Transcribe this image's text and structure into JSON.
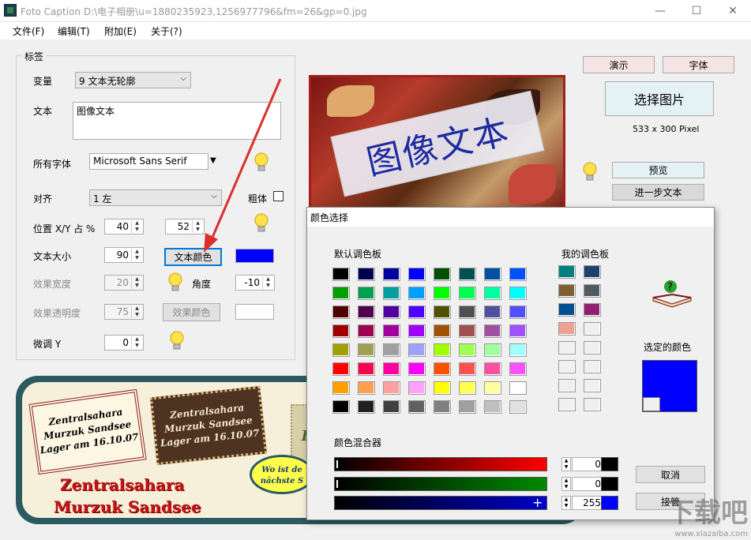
{
  "window": {
    "title": "Foto Caption D:\\电子相册\\u=1880235923,1256977796&fm=26&gp=0.jpg",
    "minimize": "—",
    "maximize": "☐",
    "close": "✕"
  },
  "menu": [
    "文件(F)",
    "编辑(T)",
    "附加(E)",
    "关于(?)"
  ],
  "group": {
    "label": "标签"
  },
  "form": {
    "variant_label": "变量",
    "variant_value": "9 文本无轮廓",
    "text_label": "文本",
    "text_value": "图像文本",
    "font_label": "所有字体",
    "font_value": "Microsoft Sans Serif",
    "align_label": "对齐",
    "align_value": "1 左",
    "bold_label": "粗体",
    "pos_label": "位置 X/Y 占 %",
    "pos_x": "40",
    "pos_y": "52",
    "size_label": "文本大小",
    "size_value": "90",
    "text_color_button": "文本颜色",
    "effect_width_label": "效果宽度",
    "effect_width_value": "20",
    "angle_label": "角度",
    "angle_value": "-10",
    "effect_opacity_label": "效果透明度",
    "effect_opacity_value": "75",
    "effect_color_button": "效果颜色",
    "fine_label": "微调 Y",
    "fine_value": "0"
  },
  "right_panel": {
    "demo_button": "演示",
    "font_button": "字体",
    "select_image_button": "选择图片",
    "image_size": "533 x 300 Pixel",
    "preview_button": "预览",
    "more_text_button": "进一步文本"
  },
  "preview_text": "图像文本",
  "banner": {
    "stamp1": [
      "Zentralsahara",
      "Murzuk Sandsee",
      "Lager am 16.10.07"
    ],
    "stamp2": [
      "Zentralsahara",
      "Murzuk Sandsee",
      "Lager am 16.10.07"
    ],
    "stamp3": "L",
    "bubble": [
      "Wo ist de",
      "nächste S"
    ],
    "big_text": [
      "Zentralsahara",
      "Murzuk Sandsee"
    ]
  },
  "dialog": {
    "title": "颜色选择",
    "default_palette_label": "默认调色板",
    "my_palette_label": "我的调色板",
    "selected_label": "选定的颜色",
    "mixer_label": "颜色混合器",
    "r_value": "0",
    "g_value": "0",
    "b_value": "255",
    "cancel_button": "取消",
    "accept_button": "接管",
    "default_palette": [
      [
        "#000000",
        "#000050",
        "#0000a0",
        "#0000ff",
        "#005000",
        "#005050",
        "#0050a0",
        "#0050ff"
      ],
      [
        "#00a000",
        "#00a050",
        "#00a0a0",
        "#00a0ff",
        "#00ff00",
        "#00ff50",
        "#00ffa0",
        "#00ffff"
      ],
      [
        "#500000",
        "#500050",
        "#5000a0",
        "#5000ff",
        "#505000",
        "#505050",
        "#5050a0",
        "#5050ff"
      ],
      [
        "#a00000",
        "#a00050",
        "#a000a0",
        "#a000ff",
        "#a05000",
        "#a05050",
        "#a050a0",
        "#a050ff"
      ],
      [
        "#a0a000",
        "#a0a050",
        "#a0a0a0",
        "#a0a0ff",
        "#a0ff00",
        "#a0ff50",
        "#a0ffa0",
        "#a0ffff"
      ],
      [
        "#ff0000",
        "#ff0050",
        "#ff00a0",
        "#ff00ff",
        "#ff5000",
        "#ff5050",
        "#ff50a0",
        "#ff50ff"
      ],
      [
        "#ffa000",
        "#ffa050",
        "#ffa0a0",
        "#ffa0ff",
        "#ffff00",
        "#ffff50",
        "#ffffa0",
        "#ffffff"
      ],
      [
        "#000000",
        "#202020",
        "#404040",
        "#606060",
        "#808080",
        "#a0a0a0",
        "#c0c0c0",
        "#e0e0e0"
      ]
    ],
    "my_palette": [
      [
        "#008080",
        "#204070"
      ],
      [
        "#806030",
        "#505a60"
      ],
      [
        "#005090",
        "#902070"
      ],
      [
        "#f0a090",
        "#f0f0f0"
      ],
      [
        "#f0f0f0",
        "#f0f0f0"
      ],
      [
        "#f0f0f0",
        "#f0f0f0"
      ],
      [
        "#f0f0f0",
        "#f0f0f0"
      ],
      [
        "#f0f0f0",
        "#f0f0f0"
      ]
    ],
    "selected_color": "#0000ff"
  },
  "colors": {
    "text_color": "#0000ff",
    "accent": "#0078d7",
    "red_arrow": "#d9302c"
  },
  "watermark": {
    "text": "下载吧",
    "sub": "www.xiazaiba.com"
  }
}
